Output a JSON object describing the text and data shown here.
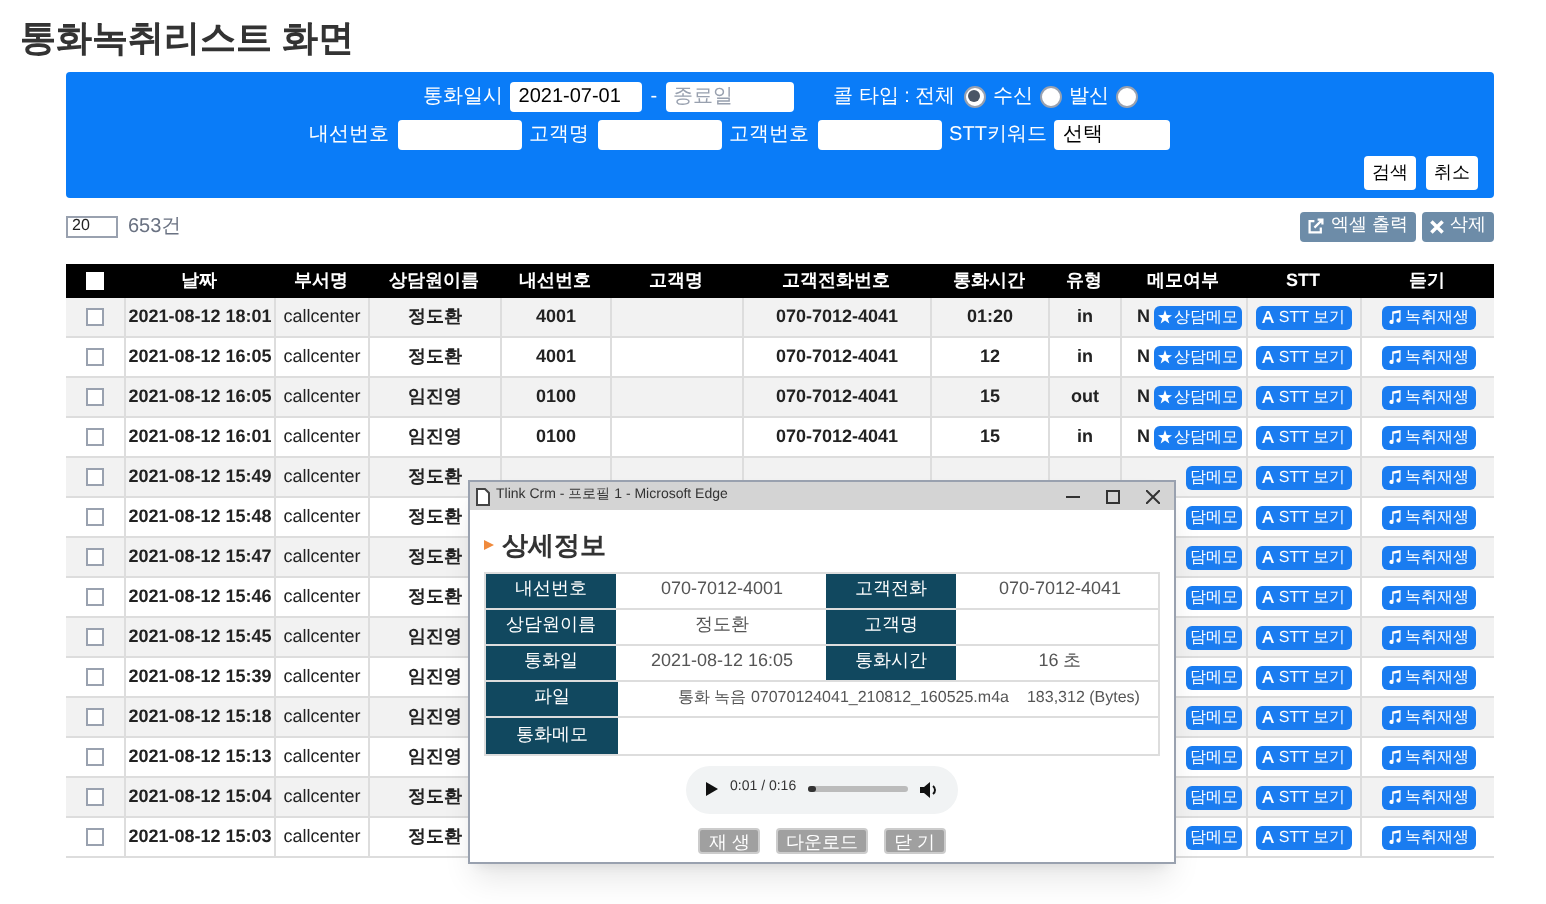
{
  "page_title": "통화녹취리스트 화면",
  "search": {
    "date_label": "통화일시",
    "start_date": "2021-07-01",
    "date_separator": "-",
    "end_date_placeholder": "종료일",
    "call_type_label": "콜 타입 : 전체",
    "call_types": [
      {
        "selected": true
      },
      {
        "label": "수신",
        "selected": false
      },
      {
        "label": "발신",
        "selected": false
      }
    ],
    "fields": [
      {
        "label": "내선번호"
      },
      {
        "label": "고객명"
      },
      {
        "label": "고객번호"
      },
      {
        "label": "STT키워드",
        "value": "선택"
      }
    ],
    "buttons": [
      "검색",
      "취소"
    ]
  },
  "toolbar": {
    "page_size": "20",
    "count": "653건",
    "buttons": [
      {
        "kind": "excel",
        "label": "엑셀 출력"
      },
      {
        "kind": "delete",
        "label": "삭제"
      }
    ]
  },
  "table": {
    "columns": [
      "날짜",
      "부서명",
      "상담원이름",
      "내선번호",
      "고객명",
      "고객전화번호",
      "통화시간",
      "유형",
      "메모여부",
      "STT",
      "듣기"
    ],
    "select_all": false,
    "rows": [
      {
        "checked": false,
        "date": "2021-08-12 18:01",
        "dept": "callcenter",
        "agent": "정도환",
        "ext": "4001",
        "phone": "070-7012-4041",
        "duration": "01:20",
        "type": "in",
        "memo_flag": "N",
        "memo": "상담메모",
        "stt": "STT 보기",
        "listen": "녹취재생"
      },
      {
        "checked": false,
        "date": "2021-08-12 16:05",
        "dept": "callcenter",
        "agent": "정도환",
        "ext": "4001",
        "phone": "070-7012-4041",
        "duration": "12",
        "type": "in",
        "memo_flag": "N",
        "memo": "상담메모",
        "stt": "STT 보기",
        "listen": "녹취재생"
      },
      {
        "checked": false,
        "date": "2021-08-12 16:05",
        "dept": "callcenter",
        "agent": "임진영",
        "ext": "0100",
        "phone": "070-7012-4041",
        "duration": "15",
        "type": "out",
        "memo_flag": "N",
        "memo": "상담메모",
        "stt": "STT 보기",
        "listen": "녹취재생"
      },
      {
        "checked": false,
        "date": "2021-08-12 16:01",
        "dept": "callcenter",
        "agent": "임진영",
        "ext": "0100",
        "phone": "070-7012-4041",
        "duration": "15",
        "type": "in",
        "memo_flag": "N",
        "memo": "상담메모",
        "stt": "STT 보기",
        "listen": "녹취재생"
      },
      {
        "checked": false,
        "date": "2021-08-12 15:49",
        "dept": "callcenter",
        "agent": "정도환",
        "memo": "담메모",
        "stt": "STT 보기",
        "listen": "녹취재생"
      },
      {
        "checked": false,
        "date": "2021-08-12 15:48",
        "dept": "callcenter",
        "agent": "정도환",
        "memo": "담메모",
        "stt": "STT 보기",
        "listen": "녹취재생"
      },
      {
        "checked": false,
        "date": "2021-08-12 15:47",
        "dept": "callcenter",
        "agent": "정도환",
        "memo": "담메모",
        "stt": "STT 보기",
        "listen": "녹취재생"
      },
      {
        "checked": false,
        "date": "2021-08-12 15:46",
        "dept": "callcenter",
        "agent": "정도환",
        "memo": "담메모",
        "stt": "STT 보기",
        "listen": "녹취재생"
      },
      {
        "checked": false,
        "date": "2021-08-12 15:45",
        "dept": "callcenter",
        "agent": "임진영",
        "memo": "담메모",
        "stt": "STT 보기",
        "listen": "녹취재생"
      },
      {
        "checked": false,
        "date": "2021-08-12 15:39",
        "dept": "callcenter",
        "agent": "임진영",
        "memo": "담메모",
        "stt": "STT 보기",
        "listen": "녹취재생"
      },
      {
        "checked": false,
        "date": "2021-08-12 15:18",
        "dept": "callcenter",
        "agent": "임진영",
        "memo": "담메모",
        "stt": "STT 보기",
        "listen": "녹취재생"
      },
      {
        "checked": false,
        "date": "2021-08-12 15:13",
        "dept": "callcenter",
        "agent": "임진영",
        "memo": "담메모",
        "stt": "STT 보기",
        "listen": "녹취재생"
      },
      {
        "checked": false,
        "date": "2021-08-12 15:04",
        "dept": "callcenter",
        "agent": "정도환",
        "memo": "담메모",
        "stt": "STT 보기",
        "listen": "녹취재생"
      },
      {
        "checked": false,
        "date": "2021-08-12 15:03",
        "dept": "callcenter",
        "agent": "정도환",
        "memo": "담메모",
        "stt": "STT 보기",
        "listen": "녹취재생"
      }
    ]
  },
  "popup": {
    "window_title": "Tlink Crm - 프로필 1 - Microsoft Edge",
    "heading": "상세정보",
    "details": [
      [
        {
          "label": "내선번호",
          "value": "070-7012-4001"
        },
        {
          "label": "고객전화",
          "value": "070-7012-4041"
        }
      ],
      [
        {
          "label": "상담원이름",
          "value": "정도환"
        },
        {
          "label": "고객명"
        }
      ],
      [
        {
          "label": "통화일",
          "value": "2021-08-12 16:05"
        },
        {
          "label": "통화시간",
          "value": "16 초"
        }
      ]
    ],
    "file_label": "파일",
    "file_name": "통화 녹음 07070124041_210812_160525.m4a",
    "file_size": "183,312 (Bytes)",
    "memo_label": "통화메모",
    "player": {
      "time": "0:01 / 0:16",
      "level": 0.07
    },
    "buttons": [
      "재 생",
      "다운로드",
      "닫 기"
    ]
  }
}
